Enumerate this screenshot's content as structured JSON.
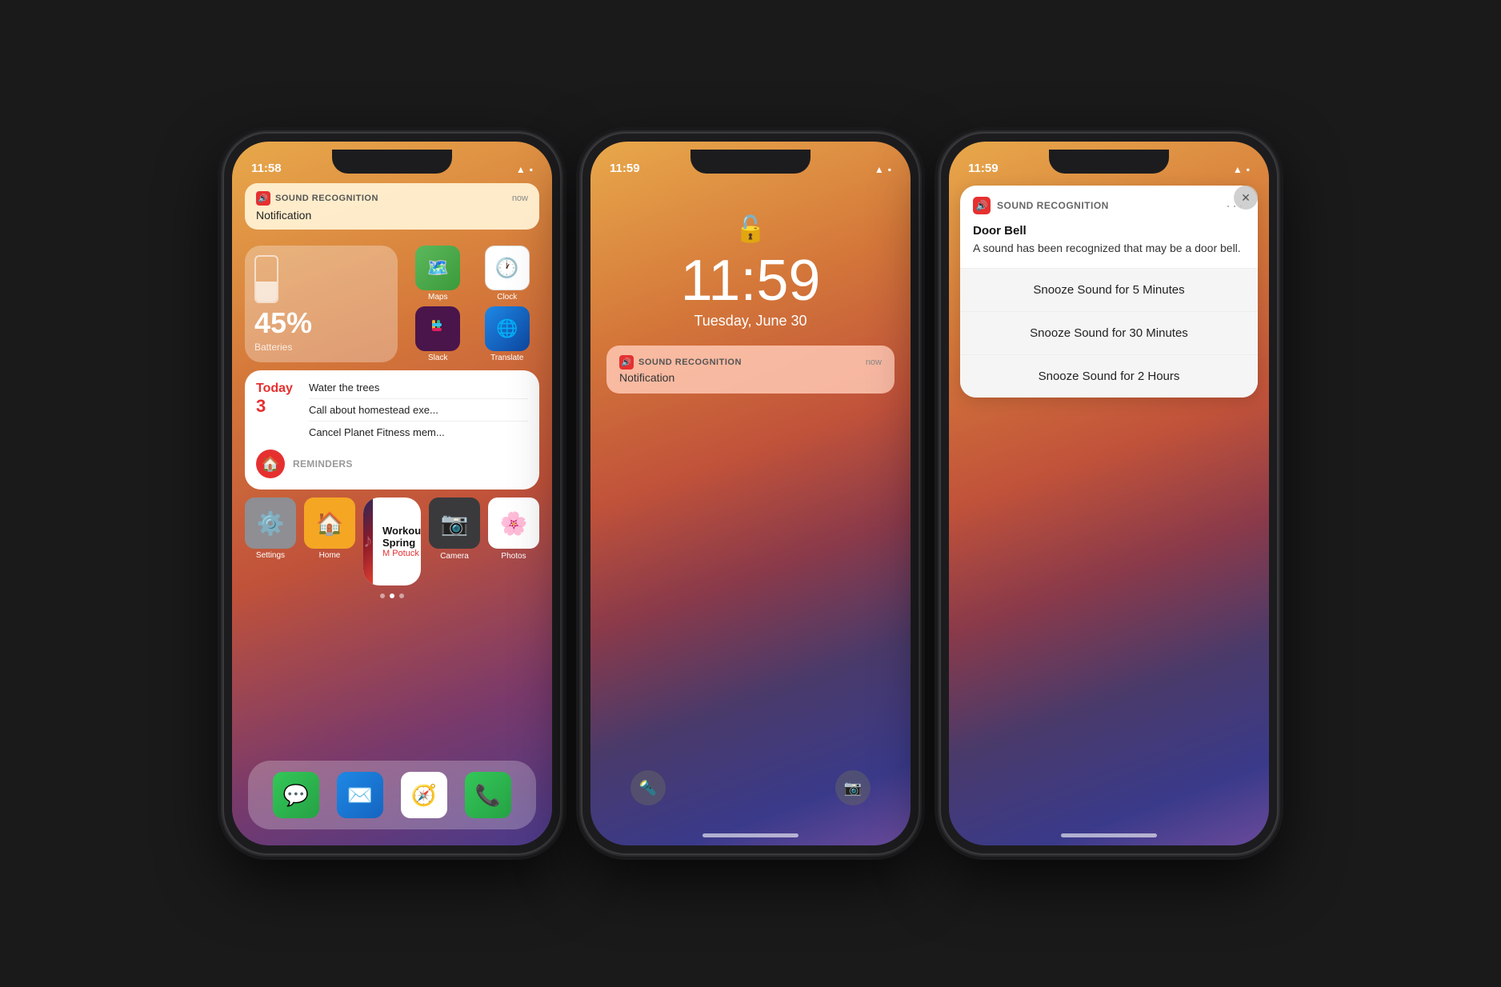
{
  "phone1": {
    "status": {
      "time": "11:58",
      "wifi": "wifi",
      "battery": "battery"
    },
    "notification": {
      "app_name": "SOUND RECOGNITION",
      "time": "now",
      "body": "Notification"
    },
    "battery_widget": {
      "percent": "45%",
      "label": "Batteries"
    },
    "apps_top": [
      {
        "name": "Maps",
        "icon": "🗺️"
      },
      {
        "name": "Clock",
        "icon": "🕐"
      },
      {
        "name": "Slack",
        "icon": "💬"
      },
      {
        "name": "Translate",
        "icon": "🌐"
      }
    ],
    "reminders_widget": {
      "today_label": "Today",
      "count": "3",
      "items": [
        "Water the trees",
        "Call about homestead exe...",
        "Cancel Planet Fitness mem..."
      ],
      "section_label": "Reminders"
    },
    "music_widget": {
      "title": "Workout Spring",
      "artist": "M Potuck"
    },
    "apps_row": [
      {
        "name": "Settings",
        "icon": "⚙️"
      },
      {
        "name": "Home",
        "icon": "🏠"
      }
    ],
    "page_dots": [
      false,
      true,
      false
    ],
    "dock_apps": [
      {
        "name": "Messages",
        "icon": "💬"
      },
      {
        "name": "Mail",
        "icon": "✉️"
      },
      {
        "name": "Safari",
        "icon": "🧭"
      },
      {
        "name": "Phone",
        "icon": "📞"
      }
    ]
  },
  "phone2": {
    "status": {
      "time": "11:59",
      "wifi": "wifi",
      "battery": "battery"
    },
    "lock_time": "11:59",
    "lock_date": "Tuesday, June 30",
    "notification": {
      "app_name": "SOUND RECOGNITION",
      "time": "now",
      "body": "Notification"
    }
  },
  "phone3": {
    "status": {
      "time": "11:59",
      "wifi": "wifi",
      "battery": "battery"
    },
    "notification": {
      "app_name": "SOUND RECOGNITION",
      "dots": "···",
      "title": "Door Bell",
      "description": "A sound has been recognized that may be a door bell."
    },
    "snooze_options": [
      "Snooze Sound for 5 Minutes",
      "Snooze Sound for 30 Minutes",
      "Snooze Sound for 2 Hours"
    ]
  }
}
